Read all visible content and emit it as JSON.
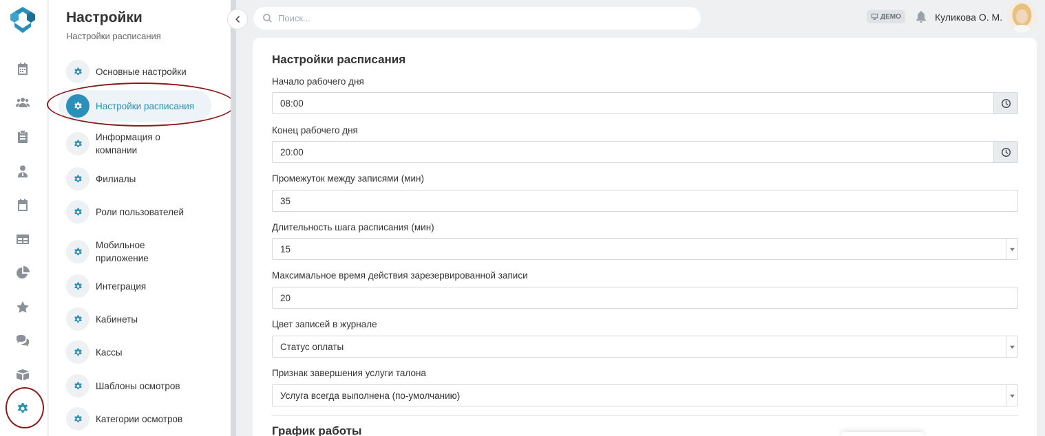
{
  "rail": {
    "items": [
      {
        "icon": "calendar-icon"
      },
      {
        "icon": "users-icon"
      },
      {
        "icon": "clipboard-icon"
      },
      {
        "icon": "doctor-icon"
      },
      {
        "icon": "schedule-icon"
      },
      {
        "icon": "table-icon"
      },
      {
        "icon": "pie-chart-icon"
      },
      {
        "icon": "star-icon"
      },
      {
        "icon": "chat-icon"
      },
      {
        "icon": "box-icon"
      },
      {
        "icon": "gear-icon",
        "active": true
      }
    ]
  },
  "sidebar": {
    "title": "Настройки",
    "subtitle": "Настройки расписания",
    "items": [
      {
        "label": "Основные настройки"
      },
      {
        "label": "Настройки расписания",
        "active": true
      },
      {
        "label": "Информация о компании"
      },
      {
        "label": "Филиалы"
      },
      {
        "label": "Роли пользователей"
      },
      {
        "label": "Мобильное приложение"
      },
      {
        "label": "Интеграция"
      },
      {
        "label": "Кабинеты"
      },
      {
        "label": "Кассы"
      },
      {
        "label": "Шаблоны осмотров"
      },
      {
        "label": "Категории осмотров"
      }
    ]
  },
  "header": {
    "search_placeholder": "Поиск...",
    "demo_label": "ДЕМО",
    "user_name": "Куликова О. М."
  },
  "main": {
    "title": "Настройки расписания",
    "fields": {
      "start_day": {
        "label": "Начало рабочего дня",
        "value": "08:00"
      },
      "end_day": {
        "label": "Конец рабочего дня",
        "value": "20:00"
      },
      "gap": {
        "label": "Промежуток между записями (мин)",
        "value": "35"
      },
      "step": {
        "label": "Длительность шага расписания (мин)",
        "value": "15"
      },
      "max_reserve": {
        "label": "Максимальное время действия зарезервированной записи",
        "value": "20"
      },
      "color": {
        "label": "Цвет записей в журнале",
        "value": "Статус оплаты"
      },
      "completion": {
        "label": "Признак завершения услуги талона",
        "value": "Услуга всегда выполнена (по-умолчанию)"
      }
    },
    "section_title": "График работы"
  },
  "colors": {
    "accent": "#2a8fb9",
    "highlight_ring": "#8b1a1a"
  }
}
